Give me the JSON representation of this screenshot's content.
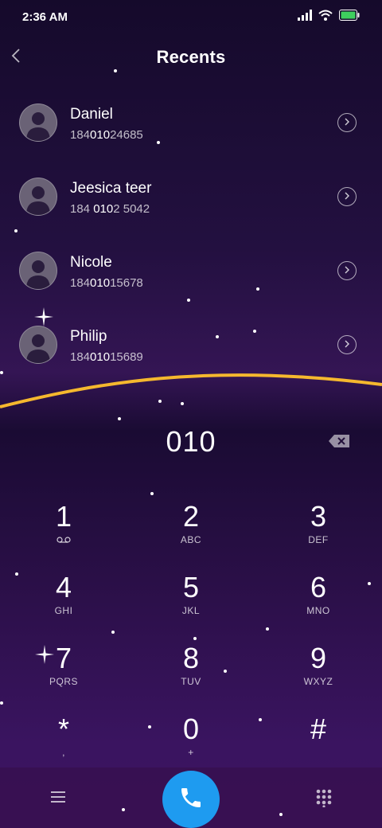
{
  "status": {
    "time": "2:36 AM"
  },
  "header": {
    "title": "Recents"
  },
  "recents": [
    {
      "name": "Daniel",
      "number_pre": "184",
      "number_match": "010",
      "number_post": "24685"
    },
    {
      "name": "Jeesica teer",
      "number_pre": "184 ",
      "number_match": "010",
      "number_post": "2 5042"
    },
    {
      "name": "Nicole",
      "number_pre": "184",
      "number_match": "010",
      "number_post": "15678"
    },
    {
      "name": "Philip",
      "number_pre": "184",
      "number_match": "010",
      "number_post": "15689"
    }
  ],
  "dial": {
    "input": "010"
  },
  "keypad": [
    {
      "digit": "1",
      "letters": ""
    },
    {
      "digit": "2",
      "letters": "ABC"
    },
    {
      "digit": "3",
      "letters": "DEF"
    },
    {
      "digit": "4",
      "letters": "GHI"
    },
    {
      "digit": "5",
      "letters": "JKL"
    },
    {
      "digit": "6",
      "letters": "MNO"
    },
    {
      "digit": "7",
      "letters": "PQRS"
    },
    {
      "digit": "8",
      "letters": "TUV"
    },
    {
      "digit": "9",
      "letters": "WXYZ"
    },
    {
      "digit": "*",
      "letters": ","
    },
    {
      "digit": "0",
      "letters": "+"
    },
    {
      "digit": "#",
      "letters": ""
    }
  ],
  "colors": {
    "accent_wave": "#f5b82e",
    "call_button": "#1e9bf0",
    "battery": "#3ecf5e"
  },
  "icons": {
    "back": "chevron-left-icon",
    "voicemail": "voicemail-icon",
    "backspace": "backspace-icon",
    "menu": "menu-icon",
    "call": "phone-icon",
    "dialpad": "dialpad-icon"
  }
}
